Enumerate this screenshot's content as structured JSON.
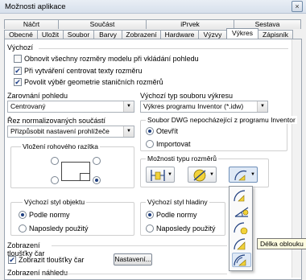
{
  "window": {
    "title": "Možnosti aplikace",
    "close_label": "×"
  },
  "tabs_top": [
    "Náčrt",
    "Součást",
    "iPrvek",
    "Sestava"
  ],
  "tabs_bottom": [
    "Obecné",
    "Uložit",
    "Soubor",
    "Barvy",
    "Zobrazení",
    "Hardware",
    "Výzvy",
    "Výkres",
    "Zápisník"
  ],
  "active_tab": "Výkres",
  "drawing": {
    "section_label": "Výchozí",
    "checkboxes": [
      {
        "label": "Obnovit všechny rozměry modelu při vkládání pohledu",
        "checked": false
      },
      {
        "label": "Při vytváření centrovat texty rozměru",
        "checked": true
      },
      {
        "label": "Povolit výběr geometrie staničních rozměrů",
        "checked": true
      }
    ],
    "align_label": "Zarovnání pohledu",
    "align_value": "Centrovaný",
    "dwg_type_label": "Výchozí typ souboru výkresu",
    "dwg_type_value": "Výkres programu Inventor (*.idw)",
    "section_std_label": "Řez normalizovaných součástí",
    "section_std_value": "Přizpůsobit nastavení prohlížeče",
    "non_inventor_label": "Soubor DWG nepocházející z programu Inventor",
    "non_inventor_options": [
      {
        "label": "Otevřít",
        "selected": true
      },
      {
        "label": "Importovat",
        "selected": false
      }
    ],
    "title_block_label": "Vložení rohového razítka",
    "dim_type_label": "Možnosti typu rozměrů",
    "object_style_label": "Výchozí styl objektu",
    "object_style_options": [
      {
        "label": "Podle normy",
        "selected": true
      },
      {
        "label": "Naposledy použitý",
        "selected": false
      }
    ],
    "layer_style_label": "Výchozí styl hladiny",
    "layer_style_options": [
      {
        "label": "Podle normy",
        "selected": true
      },
      {
        "label": "Naposledy použitý",
        "selected": false
      }
    ],
    "lineweight_label": "Zobrazení tloušťky čar",
    "lineweight_checkbox": {
      "label": "Zobrazit tloušťky čar",
      "checked": true
    },
    "settings_button": "Nastavení...",
    "preview_label": "Zobrazení náhledu"
  },
  "tooltip": "Délka oblouku",
  "accent": "#1f3f7f",
  "icon_yellow": "#f2d23a"
}
